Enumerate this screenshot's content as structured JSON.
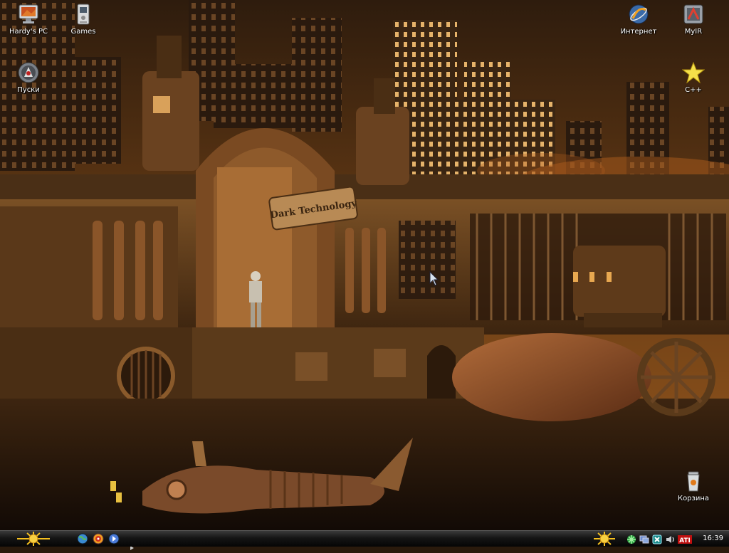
{
  "desktop": {
    "icons": [
      {
        "label": "Hardy's PC",
        "icon": "computer-icon"
      },
      {
        "label": "Games",
        "icon": "games-icon"
      },
      {
        "label": "Пуски",
        "icon": "launcher-icon"
      },
      {
        "label": "Интернет",
        "icon": "browser-icon"
      },
      {
        "label": "MyIR",
        "icon": "myir-icon"
      },
      {
        "label": "C++",
        "icon": "star-icon"
      },
      {
        "label": "Корзина",
        "icon": "recycle-bin-icon"
      }
    ]
  },
  "wallpaper": {
    "sign_text": "Dark Technology"
  },
  "taskbar": {
    "start_icon": "sun-icon",
    "quick_launch": [
      "globe-icon",
      "media-player-icon",
      "arrow-icon"
    ],
    "tray_icons": [
      "sun-icon",
      "network-icon",
      "display-icon",
      "antivirus-icon",
      "volume-icon",
      "ati-icon"
    ],
    "tray_ati_label": "ATI",
    "clock": "16:39"
  },
  "colors": {
    "taskbar": "#111111",
    "wallpaper_sky": "#5a3412",
    "wallpaper_water": "#2b1a0c"
  }
}
